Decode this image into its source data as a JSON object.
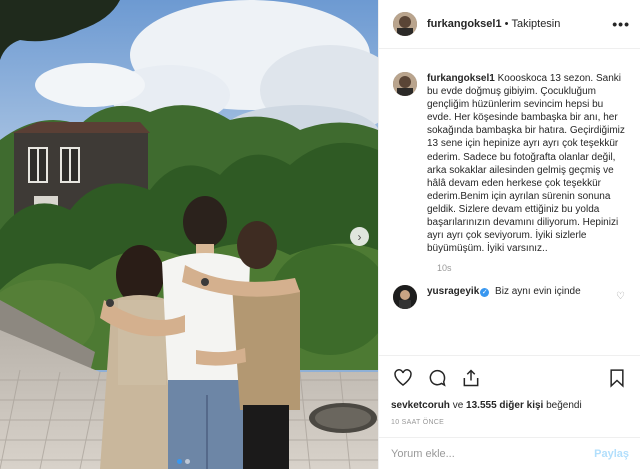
{
  "post": {
    "username": "furkangoksel1",
    "separator": "•",
    "follow_status": "Takiptesin",
    "caption": "Koooskoca 13 sezon. Sanki bu evde doğmuş gibiyim. Çocukluğum gençliğim hüzünlerim sevincim hepsi bu evde. Her köşesinde bambaşka bir anı, her sokağında bambaşka bir hatıra. Geçirdiğimiz 13 sene için hepinize ayrı ayrı çok teşekkür ederim. Sadece bu fotoğrafta olanlar değil, arka sokaklar ailesinden gelmiş geçmiş ve hâlâ devam eden herkese çok teşekkür ederim.Benim için ayrılan sürenin sonuna geldik. Sizlere devam ettiğiniz bu yolda başarılarınızın devamını diliyorum. Hepinizi ayrı ayrı çok seviyorum. İyiki sizlerle büyümüşüm. İyiki varsınız..",
    "caption_time": "10s"
  },
  "reply": {
    "username": "yusrageyik",
    "verified_mark": "✓",
    "text": "Biz aynı evin içinde"
  },
  "likes": {
    "first_user": "sevketcoruh",
    "connector": "ve",
    "others": "13.555 diğer kişi",
    "suffix": "beğendi"
  },
  "time_ago": "10 SAAT ÖNCE",
  "comment_box": {
    "placeholder": "Yorum ekle...",
    "post_label": "Paylaş"
  },
  "carousel": {
    "next_glyph": "›",
    "slide_count": 2,
    "active_slide": 1
  },
  "more_glyph": "•••",
  "icons": [
    "heart-icon",
    "comment-icon",
    "share-icon",
    "bookmark-icon",
    "chevron-right-icon",
    "more-icon",
    "small-heart-icon",
    "verified-icon"
  ],
  "colors": {
    "link_blue": "#3897f0",
    "muted_text": "#999999",
    "border": "#efefef",
    "post_button_disabled": "#b2dffc"
  }
}
